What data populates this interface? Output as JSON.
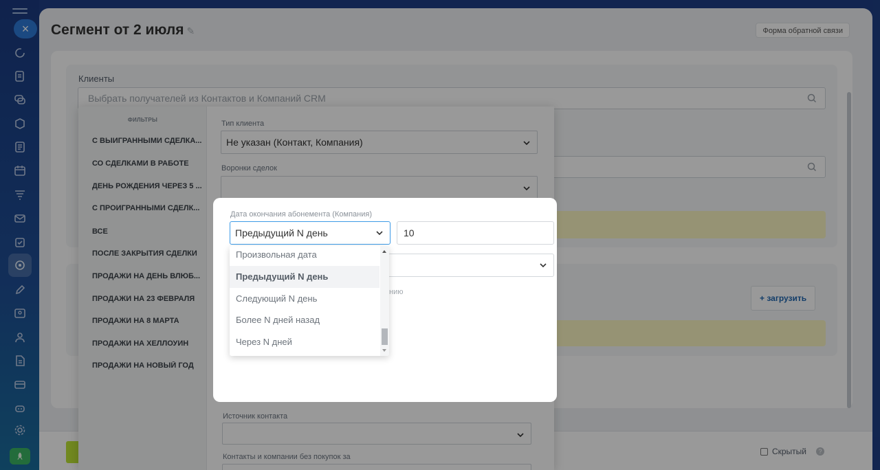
{
  "window": {
    "title": "Сегмент от 2 июля",
    "feedback_label": "Форма обратной связи"
  },
  "sidebar": {
    "icons": [
      "refresh-icon",
      "task-icon",
      "chat-icon",
      "box-icon",
      "document-icon",
      "calendar-icon",
      "filter-icon",
      "mail-icon",
      "checkbox-icon",
      "marketing-icon",
      "pen-icon",
      "contact-card-icon",
      "users-icon",
      "file-icon",
      "card-icon",
      "robot-icon",
      "gear-icon"
    ],
    "active_icon": "marketing-icon"
  },
  "clients": {
    "label": "Клиенты",
    "search_placeholder": "Выбрать получателей из Контактов и Компаний CRM"
  },
  "upload": {
    "label": "загрузить"
  },
  "filters": {
    "header": "ФИЛЬТРЫ",
    "presets": [
      "С ВЫИГРАННЫМИ СДЕЛКАМИ",
      "СО СДЕЛКАМИ В РАБОТЕ",
      "ДЕНЬ РОЖДЕНИЯ ЧЕРЕЗ 5 ДНЕЙ",
      "С ПРОИГРАННЫМИ СДЕЛКАМИ",
      "ВСЕ",
      "ПОСЛЕ ЗАКРЫТИЯ СДЕЛКИ",
      "ПРОДАЖИ НА ДЕНЬ ВЛЮБЛЕННЫХ",
      "ПРОДАЖИ НА 23 ФЕВРАЛЯ",
      "ПРОДАЖИ НА 8 МАРТА",
      "ПРОДАЖИ НА ХЕЛЛОУИН",
      "ПРОДАЖИ НА НОВЫЙ ГОД"
    ],
    "presets_display": [
      "С ВЫИГРАННЫМИ СДЕЛКА...",
      "СО СДЕЛКАМИ В РАБОТЕ",
      "ДЕНЬ РОЖДЕНИЯ ЧЕРЕЗ 5 ...",
      "С ПРОИГРАННЫМИ СДЕЛК...",
      "ВСЕ",
      "ПОСЛЕ ЗАКРЫТИЯ СДЕЛКИ",
      "ПРОДАЖИ НА ДЕНЬ ВЛЮБ...",
      "ПРОДАЖИ НА 23 ФЕВРАЛЯ",
      "ПРОДАЖИ НА 8 МАРТА",
      "ПРОДАЖИ НА ХЕЛЛОУИН",
      "ПРОДАЖИ НА НОВЫЙ ГОД"
    ],
    "client_type_label": "Тип клиента",
    "client_type_value": "Не указан (Контакт, Компания)",
    "funnels_label": "Воронки сделок",
    "funnels_value": "",
    "contact_source_label": "Источник контакта",
    "contact_source_value": "",
    "no_purchases_label": "Контакты и компании без покупок за"
  },
  "modal": {
    "field_label": "Дата окончания абонемента (Компания)",
    "period_selected": "Предыдущий N день",
    "n_value": "10",
    "hint_tail": "нию",
    "options": [
      "Произвольная дата",
      "Предыдущий N день",
      "Следующий N день",
      "Более N дней назад",
      "Через N дней"
    ],
    "selected_index": 1
  },
  "footer": {
    "hidden_label": "Скрытый",
    "hidden_checked": false
  },
  "colors": {
    "accent_blue": "#3c9ae6",
    "link_blue": "#2067b0",
    "yellow_note": "#fbf6c2",
    "save_green": "#bde336"
  }
}
